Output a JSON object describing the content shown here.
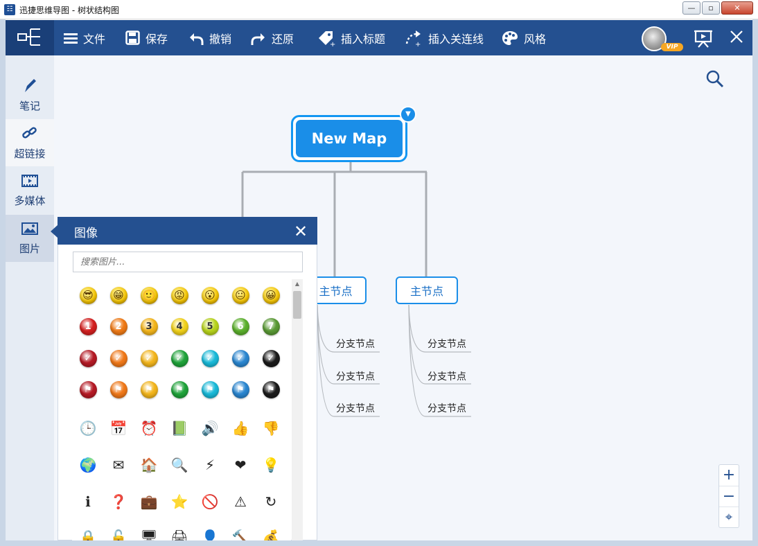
{
  "window": {
    "title": "迅捷思维导图 - 树状结构图",
    "min": "—",
    "max": "▫",
    "close": "✕"
  },
  "toolbar": {
    "items": [
      {
        "label": "文件",
        "icon": "menu-icon"
      },
      {
        "label": "保存",
        "icon": "save-icon"
      },
      {
        "label": "撤销",
        "icon": "undo-icon"
      },
      {
        "label": "还原",
        "icon": "redo-icon"
      },
      {
        "label": "插入标题",
        "icon": "tag-icon"
      },
      {
        "label": "插入关连线",
        "icon": "connector-icon"
      },
      {
        "label": "风格",
        "icon": "palette-icon"
      }
    ],
    "vip_badge": "VIP"
  },
  "sidebar": {
    "items": [
      {
        "label": "笔记",
        "icon": "pencil-icon"
      },
      {
        "label": "超链接",
        "icon": "link-icon"
      },
      {
        "label": "多媒体",
        "icon": "film-icon"
      },
      {
        "label": "图片",
        "icon": "image-icon"
      }
    ],
    "active": "图片"
  },
  "map": {
    "central": "New Map",
    "main_nodes": [
      "主节点",
      "主节点"
    ],
    "branches": [
      "分支节点",
      "分支节点",
      "分支节点",
      "分支节点",
      "分支节点",
      "分支节点"
    ]
  },
  "image_panel": {
    "title": "图像",
    "close": "✕",
    "search_placeholder": "搜索图片...",
    "rows": [
      {
        "kind": "faces",
        "items": [
          "😎",
          "😁",
          "🙂",
          "😡",
          "😮",
          "😐",
          "😀"
        ]
      },
      {
        "kind": "numbers",
        "items": [
          "1",
          "2",
          "3",
          "4",
          "5",
          "6",
          "7"
        ],
        "colors": [
          "#d32020",
          "#ef7a16",
          "#f3b51c",
          "#f1d11a",
          "#b7d31c",
          "#5bb02c",
          "#5a9a35"
        ]
      },
      {
        "kind": "checks",
        "items": [
          "✓",
          "✓",
          "✓",
          "✓",
          "✓",
          "✓",
          "✓"
        ],
        "colors": [
          "#b51a25",
          "#f07818",
          "#f3b51c",
          "#1fa33a",
          "#19b9d8",
          "#2a86d0",
          "#1a1a1a"
        ]
      },
      {
        "kind": "flags",
        "items": [
          "⚑",
          "⚑",
          "⚑",
          "⚑",
          "⚑",
          "⚑",
          "⚑"
        ],
        "colors": [
          "#b51a25",
          "#f07818",
          "#f3b51c",
          "#1fa33a",
          "#19b9d8",
          "#2a86d0",
          "#1a1a1a"
        ]
      },
      {
        "kind": "misc",
        "items": [
          "🕒",
          "📅",
          "⏰",
          "📗",
          "🔊",
          "👍",
          "👎"
        ]
      },
      {
        "kind": "misc",
        "items": [
          "🌍",
          "✉",
          "🏠",
          "🔍",
          "⚡",
          "❤",
          "💡"
        ]
      },
      {
        "kind": "misc",
        "items": [
          "ℹ",
          "❓",
          "💼",
          "⭐",
          "🚫",
          "⚠",
          "↻"
        ]
      },
      {
        "kind": "misc",
        "items": [
          "🔒",
          "🔓",
          "🖥",
          "🖨",
          "👤",
          "🔨",
          "💰"
        ]
      }
    ]
  },
  "zoom": {
    "in": "+",
    "out": "−",
    "locate": "⌖"
  }
}
